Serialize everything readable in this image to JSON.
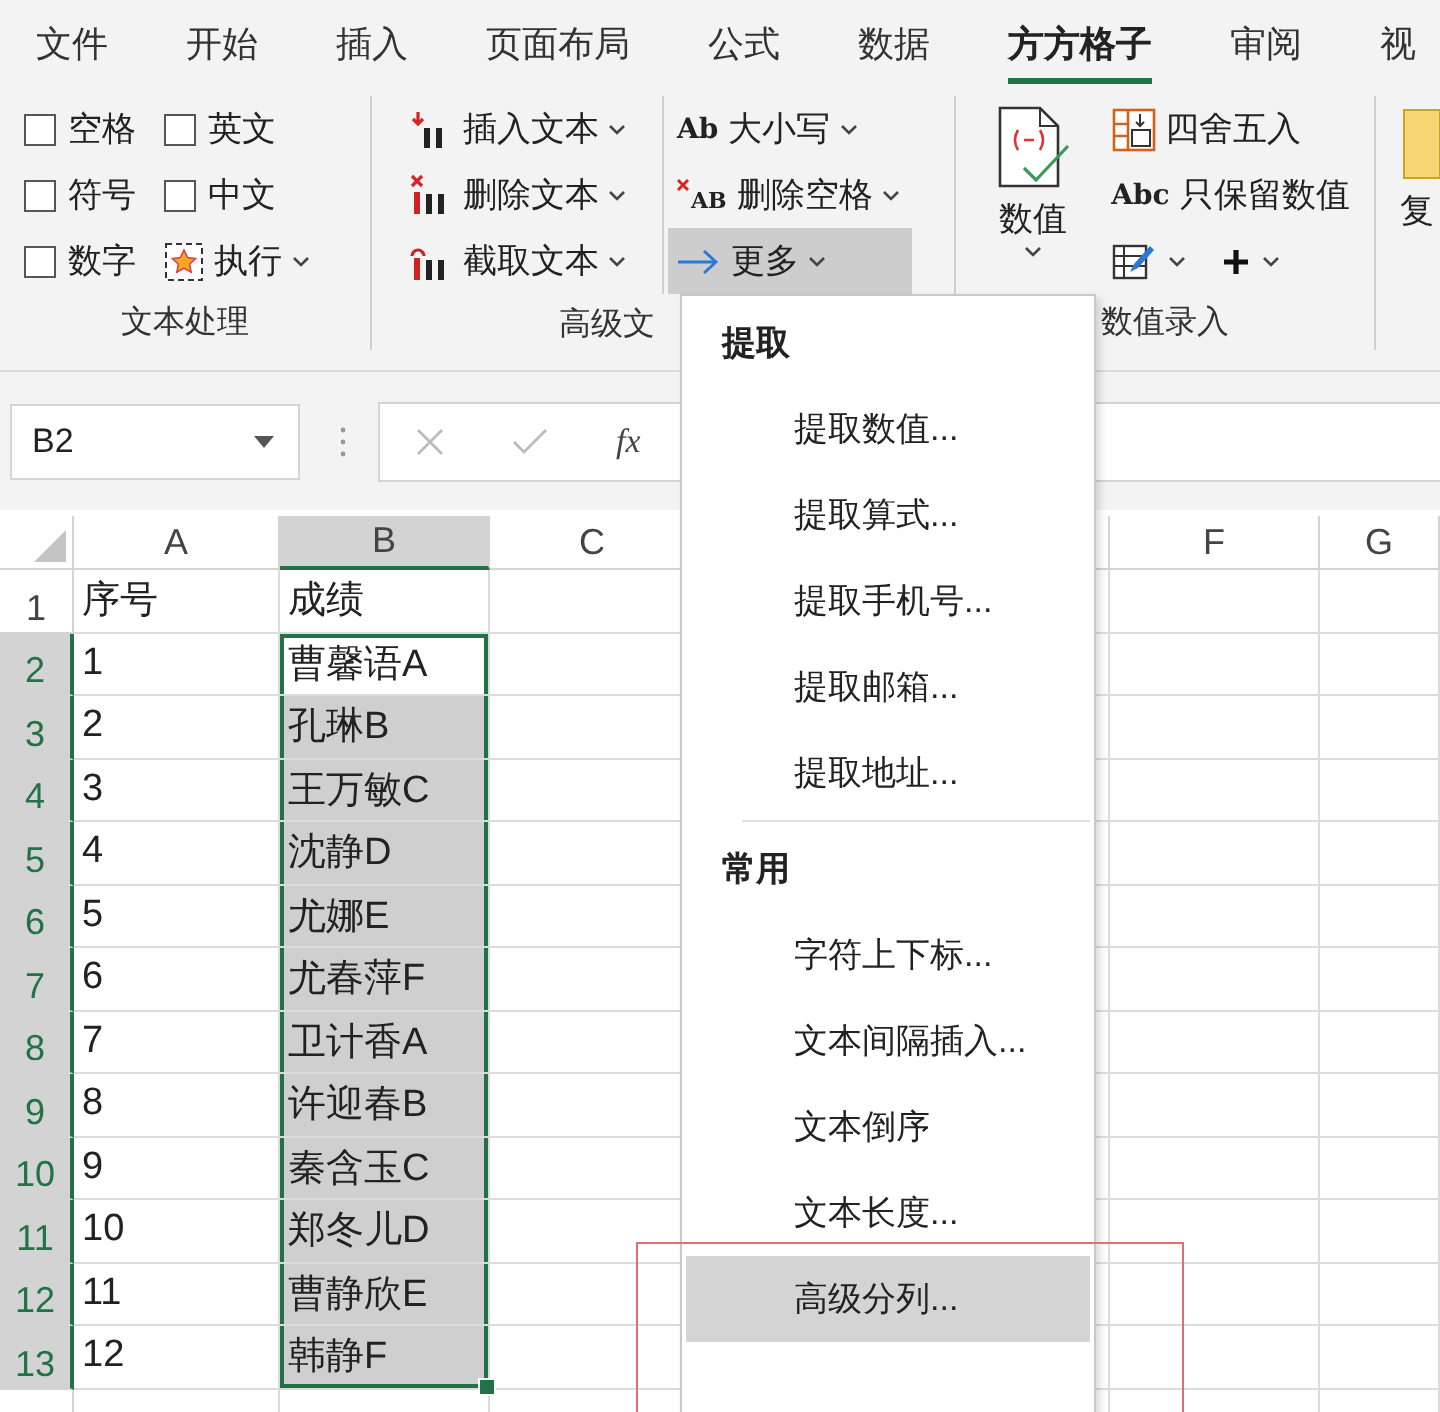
{
  "tabs": [
    {
      "label": "文件",
      "selected": false
    },
    {
      "label": "开始",
      "selected": false
    },
    {
      "label": "插入",
      "selected": false
    },
    {
      "label": "页面布局",
      "selected": false
    },
    {
      "label": "公式",
      "selected": false
    },
    {
      "label": "数据",
      "selected": false
    },
    {
      "label": "方方格子",
      "selected": true
    },
    {
      "label": "审阅",
      "selected": false
    },
    {
      "label": "视",
      "selected": false
    }
  ],
  "ribbon": {
    "groups": [
      {
        "kind": "checks",
        "label": "文本处理",
        "checkboxes": [
          {
            "label": "空格",
            "checked": false
          },
          {
            "label": "英文",
            "checked": false
          },
          {
            "label": "符号",
            "checked": false
          },
          {
            "label": "中文",
            "checked": false
          },
          {
            "label": "数字",
            "checked": false
          }
        ],
        "run_button": "执行"
      },
      {
        "kind": "text_tools",
        "label": "高级文",
        "columns": [
          [
            {
              "label": "插入文本",
              "kind": "insert",
              "pressed": false
            },
            {
              "label": "删除文本",
              "kind": "delete",
              "pressed": false
            },
            {
              "label": "截取文本",
              "kind": "cut",
              "pressed": false
            }
          ],
          [
            {
              "label": "大小写",
              "kind": "glyph",
              "glyph": "Ab",
              "pressed": false
            },
            {
              "label": "删除空格",
              "kind": "glyph_x",
              "glyph": "AB",
              "pressed": false
            },
            {
              "label": "更多",
              "kind": "arrow",
              "pressed": true
            }
          ]
        ]
      },
      {
        "kind": "numbers",
        "label": "数值录入",
        "big_button": "数值",
        "items": [
          {
            "label": "四舍五入",
            "kind": "round"
          },
          {
            "label": "只保留数值",
            "kind": "glyph",
            "glyph": "Abc"
          }
        ],
        "small_buttons": [
          {
            "kind": "table_edit"
          },
          {
            "kind": "plus"
          }
        ]
      },
      {
        "kind": "cut",
        "button": "复"
      }
    ]
  },
  "formula_bar": {
    "name_box": "B2",
    "fx": "fx"
  },
  "grid": {
    "columns": [
      {
        "kind": "visible",
        "label": "A",
        "selected": false
      },
      {
        "kind": "visible",
        "label": "B",
        "selected": true
      },
      {
        "kind": "visible",
        "label": "C",
        "selected": false
      },
      {
        "kind": "covered"
      },
      {
        "kind": "partial"
      },
      {
        "kind": "visible",
        "label": "F",
        "selected": false
      },
      {
        "kind": "visible",
        "label": "G",
        "selected": false
      }
    ],
    "rows": [
      {
        "label": "1",
        "selected": false,
        "cells": [
          {
            "text": "序号",
            "selected": false
          },
          {
            "text": "成绩",
            "selected": false
          }
        ]
      },
      {
        "label": "2",
        "selected": true,
        "cells": [
          {
            "text": "1",
            "selected": false
          },
          {
            "text": "曹馨语A",
            "selected": true
          }
        ]
      },
      {
        "label": "3",
        "selected": true,
        "cells": [
          {
            "text": "2",
            "selected": false
          },
          {
            "text": "孔琳B",
            "selected": true
          }
        ]
      },
      {
        "label": "4",
        "selected": true,
        "cells": [
          {
            "text": "3",
            "selected": false
          },
          {
            "text": "王万敏C",
            "selected": true
          }
        ]
      },
      {
        "label": "5",
        "selected": true,
        "cells": [
          {
            "text": "4",
            "selected": false
          },
          {
            "text": "沈静D",
            "selected": true
          }
        ]
      },
      {
        "label": "6",
        "selected": true,
        "cells": [
          {
            "text": "5",
            "selected": false
          },
          {
            "text": "尤娜E",
            "selected": true
          }
        ]
      },
      {
        "label": "7",
        "selected": true,
        "cells": [
          {
            "text": "6",
            "selected": false
          },
          {
            "text": "尤春萍F",
            "selected": true
          }
        ]
      },
      {
        "label": "8",
        "selected": true,
        "cells": [
          {
            "text": "7",
            "selected": false
          },
          {
            "text": "卫计香A",
            "selected": true
          }
        ]
      },
      {
        "label": "9",
        "selected": true,
        "cells": [
          {
            "text": "8",
            "selected": false
          },
          {
            "text": "许迎春B",
            "selected": true
          }
        ]
      },
      {
        "label": "10",
        "selected": true,
        "cells": [
          {
            "text": "9",
            "selected": false
          },
          {
            "text": "秦含玉C",
            "selected": true
          }
        ]
      },
      {
        "label": "11",
        "selected": true,
        "cells": [
          {
            "text": "10",
            "selected": false
          },
          {
            "text": "郑冬儿D",
            "selected": true
          }
        ]
      },
      {
        "label": "12",
        "selected": true,
        "cells": [
          {
            "text": "11",
            "selected": false
          },
          {
            "text": "曹静欣E",
            "selected": true
          }
        ]
      },
      {
        "label": "13",
        "selected": true,
        "cells": [
          {
            "text": "12",
            "selected": false
          },
          {
            "text": "韩静F",
            "selected": true
          }
        ]
      }
    ]
  },
  "menu": {
    "sections": [
      {
        "title": "提取",
        "items": [
          {
            "label": "提取数值...",
            "selected": false
          },
          {
            "label": "提取算式...",
            "selected": false
          },
          {
            "label": "提取手机号...",
            "selected": false
          },
          {
            "label": "提取邮箱...",
            "selected": false
          },
          {
            "label": "提取地址...",
            "selected": false
          }
        ]
      },
      {
        "title": "常用",
        "items": [
          {
            "label": "字符上下标...",
            "selected": false
          },
          {
            "label": "文本间隔插入...",
            "selected": false
          },
          {
            "label": "文本倒序",
            "selected": false
          },
          {
            "label": "文本长度...",
            "selected": false
          },
          {
            "label": "高级分列...",
            "selected": true
          }
        ]
      }
    ]
  },
  "highlight_frame": true
}
